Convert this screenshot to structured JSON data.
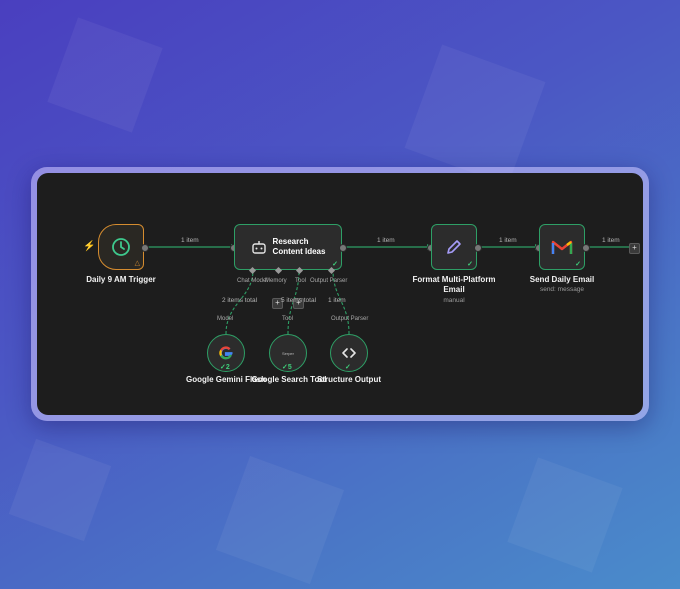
{
  "workflow": {
    "nodes": {
      "trigger": {
        "label": "Daily 9 AM Trigger"
      },
      "agent": {
        "label": "Research\nContent Ideas",
        "line1": "Research",
        "line2": "Content Ideas"
      },
      "format": {
        "label": "Format Multi-Platform\nEmail",
        "line1": "Format Multi-Platform",
        "line2": "Email",
        "sub": "manual"
      },
      "send": {
        "label": "Send Daily Email",
        "sub": "send: message"
      },
      "gemini": {
        "label": "Google Gemini Flash",
        "count": "2"
      },
      "search": {
        "label": "Google Search Tool",
        "count": "5",
        "icon_text": "Serper"
      },
      "structure": {
        "label": "Structure Output"
      }
    },
    "edges": {
      "trigger_agent": "1 item",
      "agent_format": "1 item",
      "format_send": "1 item",
      "send_out": "1 item",
      "gemini_agent": "2 items total",
      "search_agent": "5 items total",
      "structure_agent": "1 item"
    },
    "ports": {
      "chat_model": "Chat Model",
      "memory": "Memory",
      "tool": "Tool",
      "output_parser": "Output Parser",
      "model_lbl": "Model",
      "tool_lbl": "Tool",
      "parser_lbl": "Output Parser"
    },
    "colors": {
      "success": "#2e9f66",
      "trigger": "#d58c2f",
      "canvas": "#1d1d1d"
    }
  }
}
